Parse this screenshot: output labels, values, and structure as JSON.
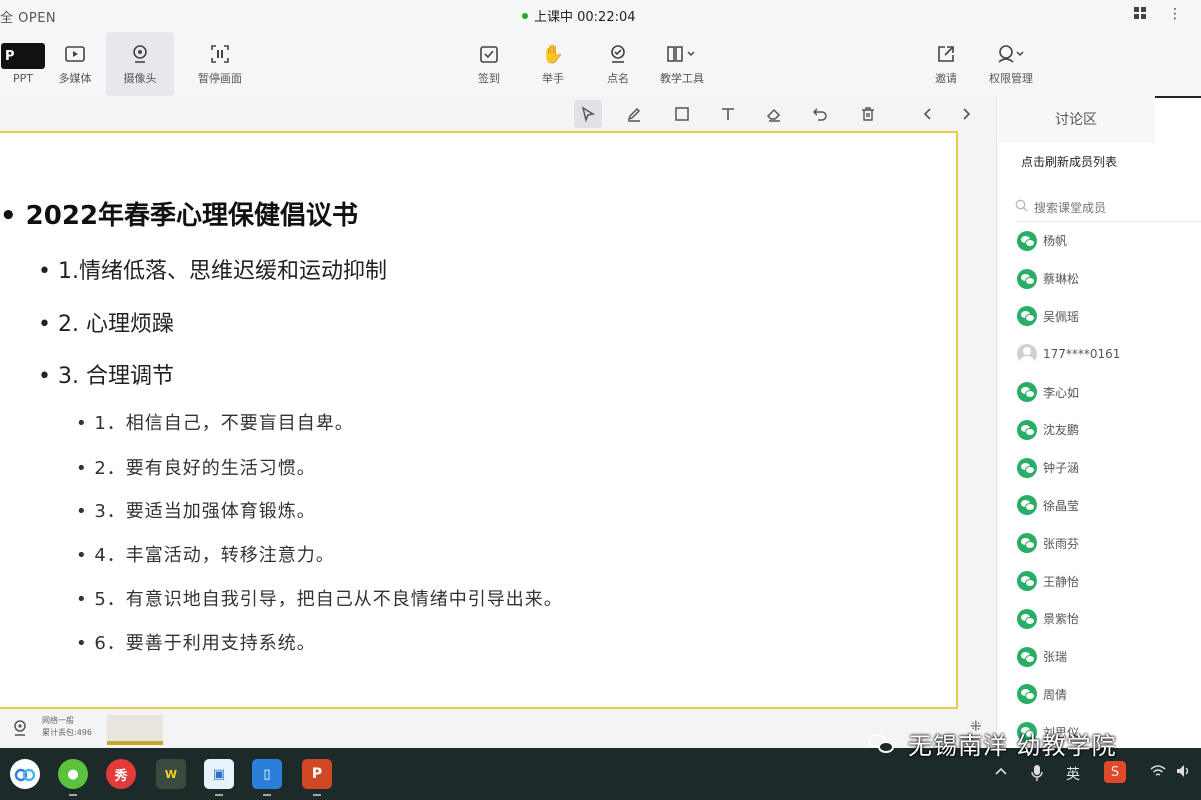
{
  "titlebar": {
    "app_name": "全 OPEN",
    "status": "上课中 00:22:04",
    "grid_icon": "grid-icon",
    "more_icon": "more-vertical-icon"
  },
  "toolbar": {
    "ppt": {
      "label": "PPT",
      "chip": "P"
    },
    "multimedia": "多媒体",
    "camera": "摄像头",
    "pause_screen": "暂停画面",
    "signin": "签到",
    "raise_hand": "举手",
    "roll_call": "点名",
    "teaching_tools": "教学工具",
    "invite": "邀请",
    "permissions": "权限管理"
  },
  "drawing_tools": [
    "pointer-icon",
    "pen-icon",
    "rectangle-icon",
    "text-icon",
    "eraser-icon",
    "undo-icon",
    "delete-icon",
    "prev-page-icon",
    "next-page-icon"
  ],
  "slide": {
    "title": "• 2022年春季心理保健倡议书",
    "points": [
      "• 1.情绪低落、思维迟缓和运动抑制",
      "• 2. 心理烦躁",
      "• 3. 合理调节"
    ],
    "subpoints": [
      "• 1．相信自己，不要盲目自卑。",
      "• 2．要有良好的生活习惯。",
      "• 3．要适当加强体育锻炼。",
      "• 4．丰富活动，转移注意力。",
      "• 5．有意识地自我引导，把自己从不良情绪中引导出来。",
      "• 6．要善于利用支持系统。"
    ]
  },
  "footer": {
    "net_line1": "网络一般",
    "net_line2": "累计丢包:496"
  },
  "panel": {
    "tab_discussion": "讨论区",
    "refresh_label": "点击刷新成员列表",
    "search_placeholder": "搜索课堂成员",
    "members": [
      {
        "name": "杨帆",
        "type": "wechat"
      },
      {
        "name": "蔡琳松",
        "type": "wechat"
      },
      {
        "name": "吴佩瑶",
        "type": "wechat"
      },
      {
        "name": "177****0161",
        "type": "guest"
      },
      {
        "name": "李心如",
        "type": "wechat"
      },
      {
        "name": "沈友鹏",
        "type": "wechat"
      },
      {
        "name": "钟子涵",
        "type": "wechat"
      },
      {
        "name": "徐晶莹",
        "type": "wechat"
      },
      {
        "name": "张雨芬",
        "type": "wechat"
      },
      {
        "name": "王静怡",
        "type": "wechat"
      },
      {
        "name": "景紫怡",
        "type": "wechat"
      },
      {
        "name": "张瑞",
        "type": "wechat"
      },
      {
        "name": "周倩",
        "type": "wechat"
      },
      {
        "name": "刘思仪",
        "type": "wechat"
      }
    ]
  },
  "taskbar": {
    "apps": [
      "baidu-netdisk-icon",
      "wechat-app-icon",
      "pdf-app-icon",
      "wps-app-icon",
      "classroom-app-icon",
      "tablet-app-icon",
      "powerpoint-app-icon"
    ],
    "ime_label": "英",
    "tray_icons": [
      "chevron-up-icon",
      "microphone-icon",
      "sogou-icon",
      "wifi-icon",
      "volume-icon"
    ]
  },
  "watermark": {
    "text": "无锡南洋 幼教学院"
  },
  "colors": {
    "accent_green": "#1aad19",
    "slide_border": "#e6c84a",
    "wechat_green": "#2aae67",
    "taskbar_bg": "#1c2a2a"
  }
}
